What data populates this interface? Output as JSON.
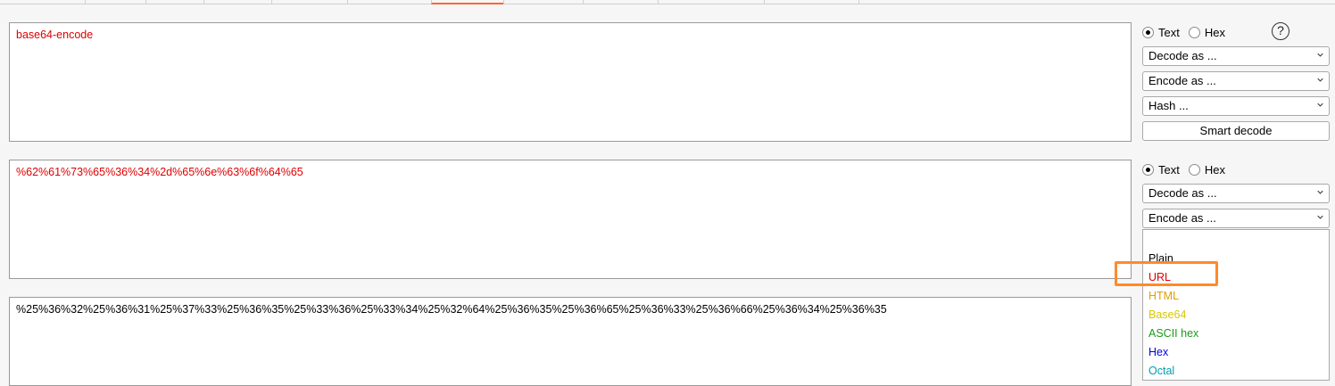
{
  "panels": {
    "input": {
      "text": "base64-encode",
      "color": "#e00000"
    },
    "encoded": {
      "text": "%62%61%73%65%36%34%2d%65%6e%63%6f%64%65",
      "color": "#e00000"
    },
    "output": {
      "text": "%25%36%32%25%36%31%25%37%33%25%36%35%25%33%36%25%33%34%25%32%64%25%36%35%25%36%65%25%36%33%25%36%66%25%36%34%25%36%35",
      "color": "#000000"
    }
  },
  "controls_1": {
    "text_label": "Text",
    "hex_label": "Hex",
    "selected": "Text",
    "help_label": "?",
    "decode_as": "Decode as ...",
    "encode_as": "Encode as ...",
    "hash": "Hash ...",
    "smart_decode": "Smart decode"
  },
  "controls_2": {
    "text_label": "Text",
    "hex_label": "Hex",
    "selected": "Text",
    "decode_as": "Decode as ...",
    "encode_as": "Encode as ..."
  },
  "encode_dropdown": {
    "options": [
      {
        "label": "Plain",
        "color": "#000000"
      },
      {
        "label": "URL",
        "color": "#e00000"
      },
      {
        "label": "HTML",
        "color": "#e0a000"
      },
      {
        "label": "Base64",
        "color": "#d8c800"
      },
      {
        "label": "ASCII hex",
        "color": "#1a9a1a"
      },
      {
        "label": "Hex",
        "color": "#0000e0"
      },
      {
        "label": "Octal",
        "color": "#00a0b0"
      }
    ],
    "highlighted": "URL",
    "highlight_color": "#ff8a2a"
  },
  "accent_color": "#ff6633"
}
